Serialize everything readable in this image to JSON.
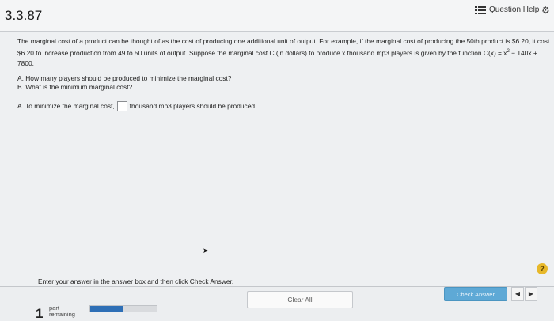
{
  "header": {
    "question_number": "3.3.87",
    "help_label": "Question Help"
  },
  "problem": {
    "text_before": "The marginal cost of a product can be thought of as the cost of producing one additional unit of output. For example, if the marginal cost of producing the 50th product is $6.20, it cost $6.20 to increase production from 49 to 50 units of output. Suppose the marginal cost C (in dollars) to produce x thousand mp3 players is given by the function C(x) = x",
    "exponent": "2",
    "text_after": " − 140x + 7800."
  },
  "parts": {
    "a": "A. How many players should be produced to minimize the marginal cost?",
    "b": "B. What is the minimum marginal cost?"
  },
  "answer": {
    "prefix": "A. To minimize the marginal cost,",
    "value": "",
    "suffix": "thousand mp3 players should be produced."
  },
  "instruction": "Enter your answer in the answer box and then click Check Answer.",
  "help_circle": "?",
  "footer": {
    "parts_remaining_count": "1",
    "parts_remaining_label_1": "part",
    "parts_remaining_label_2": "remaining",
    "progress_fraction": 0.5,
    "clear_all_label": "Clear All",
    "check_answer_label": "Check Answer",
    "prev_label": "◀",
    "next_label": "▶"
  },
  "icons": {
    "help_list": "list-icon",
    "settings": "gear-icon",
    "cursor": "pointer-cursor"
  },
  "colors": {
    "check_button": "#5ea9d6",
    "progress_fill": "#2e6fb6",
    "help_circle": "#e7b82a"
  }
}
